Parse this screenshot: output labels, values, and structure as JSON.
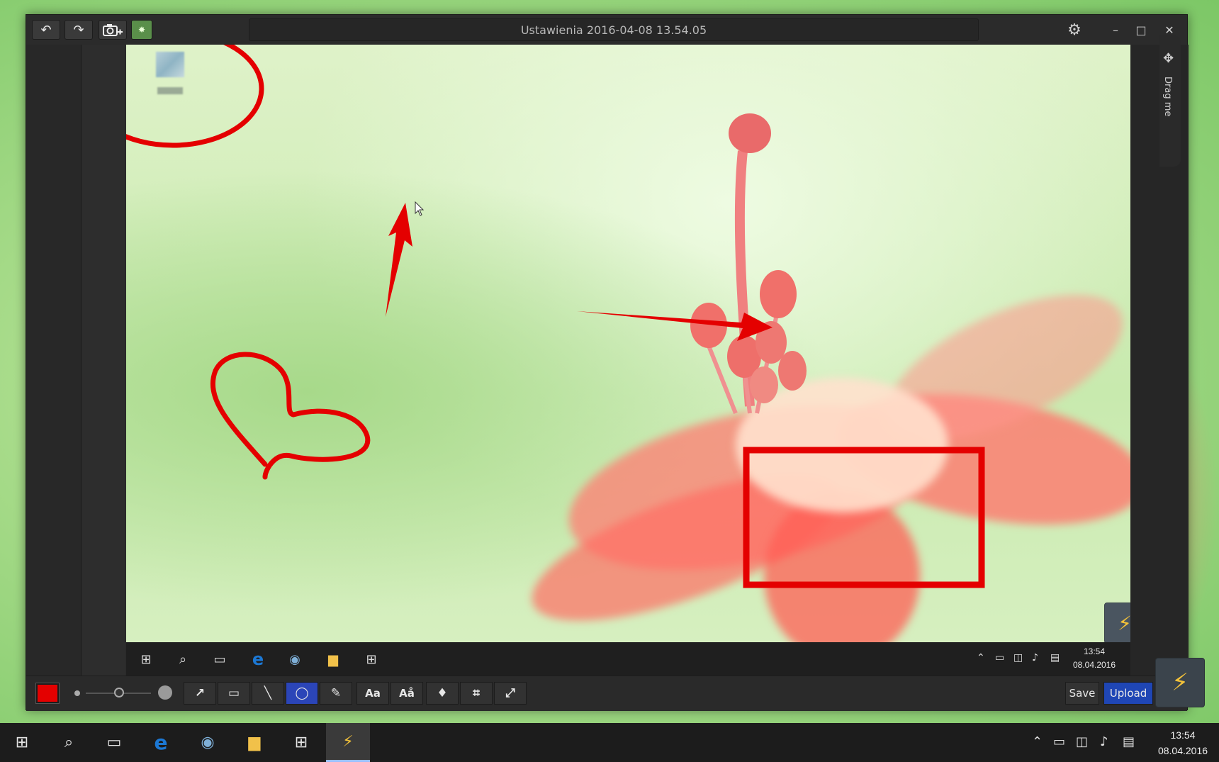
{
  "window": {
    "title": "Ustawienia 2016-04-08 13.54.05",
    "drag_label": "Drag me"
  },
  "titlebar": {
    "undo_icon": "undo-icon",
    "redo_icon": "redo-icon",
    "capture_icon": "camera-plus-icon",
    "fx_icon": "fx-icon",
    "settings_icon": "gear-icon",
    "minimize": "–",
    "maximize": "□",
    "close": "✕"
  },
  "inner_taskbar": {
    "time": "13:54",
    "date": "08.04.2016"
  },
  "toolbar": {
    "color": "#e40000",
    "tools": [
      {
        "name": "arrow-tool",
        "glyph": "↗"
      },
      {
        "name": "rectangle-tool",
        "glyph": "▭"
      },
      {
        "name": "line-tool",
        "glyph": "╲"
      },
      {
        "name": "ellipse-tool",
        "glyph": "◯",
        "active": true
      },
      {
        "name": "pen-tool",
        "glyph": "✎"
      },
      {
        "name": "text-tool",
        "glyph": "Aa"
      },
      {
        "name": "text-style-tool",
        "glyph": "Aå"
      },
      {
        "name": "blur-tool",
        "glyph": "💧"
      },
      {
        "name": "crop-tool",
        "glyph": "⌗"
      },
      {
        "name": "resize-tool",
        "glyph": "⤢"
      }
    ],
    "save_label": "Save",
    "upload_label": "Upload",
    "menu_glyph": "☰"
  },
  "taskbar": {
    "time": "13:54",
    "date": "08.04.2016"
  },
  "colors": {
    "annotation": "#e40000",
    "active_tool": "#2b45b8",
    "upload_button": "#1f46b5"
  }
}
